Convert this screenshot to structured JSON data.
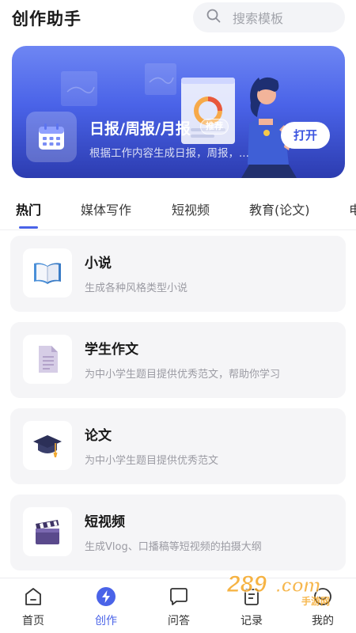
{
  "header": {
    "title": "创作助手",
    "search_placeholder": "搜索模板"
  },
  "banner": {
    "title": "日报/周报/月报",
    "badge": "推荐",
    "description": "根据工作内容生成日报，周报，...",
    "open_button": "打开",
    "colors": {
      "top": "#6e86f3",
      "bottom": "#2c3cb0"
    }
  },
  "tabs": [
    {
      "label": "热门",
      "active": true
    },
    {
      "label": "媒体写作",
      "active": false
    },
    {
      "label": "短视频",
      "active": false
    },
    {
      "label": "教育(论文)",
      "active": false
    },
    {
      "label": "电",
      "active": false
    }
  ],
  "templates": [
    {
      "title": "小说",
      "description": "生成各种风格类型小说",
      "icon": "open-book-icon"
    },
    {
      "title": "学生作文",
      "description": "为中小学生题目提供优秀范文，帮助你学习",
      "icon": "document-icon"
    },
    {
      "title": "论文",
      "description": "为中小学生题目提供优秀范文",
      "icon": "graduation-cap-icon"
    },
    {
      "title": "短视频",
      "description": "生成Vlog、口播稿等短视频的拍摄大纲",
      "icon": "clapperboard-icon"
    }
  ],
  "bottom_nav": [
    {
      "label": "首页",
      "icon": "home-icon",
      "active": false
    },
    {
      "label": "创作",
      "icon": "lightning-icon",
      "active": true
    },
    {
      "label": "问答",
      "icon": "chat-bubble-icon",
      "active": false
    },
    {
      "label": "记录",
      "icon": "record-icon",
      "active": false
    },
    {
      "label": "我的",
      "icon": "profile-icon",
      "active": false
    }
  ],
  "watermark": {
    "text": "289.com",
    "sub": "手游网"
  },
  "accent_color": "#4a63e8"
}
